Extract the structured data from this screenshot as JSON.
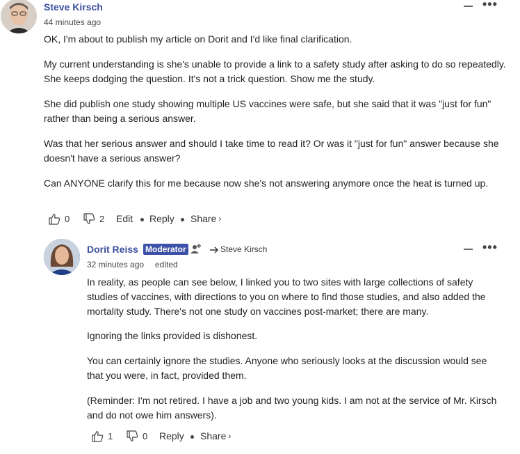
{
  "comments": [
    {
      "author": "Steve Kirsch",
      "time": "44 minutes ago",
      "paragraphs": [
        "OK, I'm about to publish my article on Dorit and I'd like final clarification.",
        "My current understanding is she's unable to provide a link to a safety study after asking to do so repeatedly. She keeps dodging the question. It's not a trick question. Show me the study.",
        "She did publish one study showing multiple US vaccines were safe, but she said that it was \"just for fun\" rather than being a serious answer.",
        "Was that her serious answer and should I take time to read it? Or was it \"just for fun\" answer because she doesn't have a serious answer?",
        "Can ANYONE clarify this for me because now she's not answering anymore once the heat is turned up."
      ],
      "likes": "0",
      "dislikes": "2",
      "edit_label": "Edit",
      "reply_label": "Reply",
      "share_label": "Share",
      "share_chevron": "›"
    },
    {
      "author": "Dorit Reiss",
      "badge": "Moderator",
      "reply_to": "Steve Kirsch",
      "time": "32 minutes ago",
      "edited": "edited",
      "paragraphs": [
        "In reality, as people can see below, I linked you to two sites with large collections of safety studies of vaccines, with directions to you on where to find those studies, and also added the mortality study. There's not one study on vaccines post-market; there are many.",
        "Ignoring the links provided is dishonest.",
        "You can certainly ignore the studies. Anyone who seriously looks at the discussion would see that you were, in fact, provided them.",
        "(Reminder: I'm not retired. I have a job and two young kids. I am not at the service of Mr. Kirsch and do not owe him answers)."
      ],
      "likes": "1",
      "dislikes": "0",
      "reply_label": "Reply",
      "share_label": "Share",
      "share_chevron": "›"
    }
  ],
  "more_label": "•••",
  "icons": {
    "like": "thumbs-up-icon",
    "dislike": "thumbs-down-icon",
    "collapse": "minus-icon",
    "more": "more-dots-icon",
    "reply_arrow": "reply-arrow-icon",
    "add_moderator": "add-user-icon"
  },
  "colors": {
    "author": "#3b4fa0",
    "badge_bg": "#3d51a8",
    "text": "#222222"
  }
}
